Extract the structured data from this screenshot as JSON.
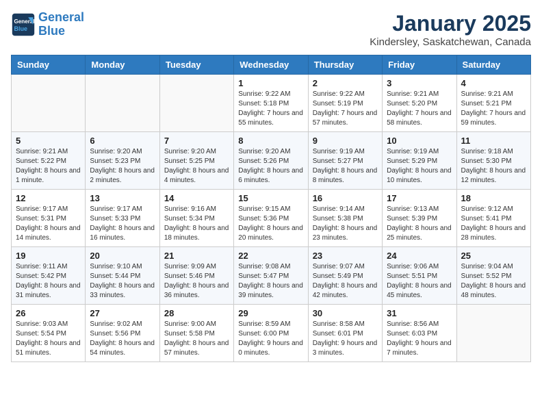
{
  "header": {
    "logo_line1": "General",
    "logo_line2": "Blue",
    "month": "January 2025",
    "location": "Kindersley, Saskatchewan, Canada"
  },
  "weekdays": [
    "Sunday",
    "Monday",
    "Tuesday",
    "Wednesday",
    "Thursday",
    "Friday",
    "Saturday"
  ],
  "weeks": [
    [
      {
        "day": "",
        "info": ""
      },
      {
        "day": "",
        "info": ""
      },
      {
        "day": "",
        "info": ""
      },
      {
        "day": "1",
        "info": "Sunrise: 9:22 AM\nSunset: 5:18 PM\nDaylight: 7 hours and 55 minutes."
      },
      {
        "day": "2",
        "info": "Sunrise: 9:22 AM\nSunset: 5:19 PM\nDaylight: 7 hours and 57 minutes."
      },
      {
        "day": "3",
        "info": "Sunrise: 9:21 AM\nSunset: 5:20 PM\nDaylight: 7 hours and 58 minutes."
      },
      {
        "day": "4",
        "info": "Sunrise: 9:21 AM\nSunset: 5:21 PM\nDaylight: 7 hours and 59 minutes."
      }
    ],
    [
      {
        "day": "5",
        "info": "Sunrise: 9:21 AM\nSunset: 5:22 PM\nDaylight: 8 hours and 1 minute."
      },
      {
        "day": "6",
        "info": "Sunrise: 9:20 AM\nSunset: 5:23 PM\nDaylight: 8 hours and 2 minutes."
      },
      {
        "day": "7",
        "info": "Sunrise: 9:20 AM\nSunset: 5:25 PM\nDaylight: 8 hours and 4 minutes."
      },
      {
        "day": "8",
        "info": "Sunrise: 9:20 AM\nSunset: 5:26 PM\nDaylight: 8 hours and 6 minutes."
      },
      {
        "day": "9",
        "info": "Sunrise: 9:19 AM\nSunset: 5:27 PM\nDaylight: 8 hours and 8 minutes."
      },
      {
        "day": "10",
        "info": "Sunrise: 9:19 AM\nSunset: 5:29 PM\nDaylight: 8 hours and 10 minutes."
      },
      {
        "day": "11",
        "info": "Sunrise: 9:18 AM\nSunset: 5:30 PM\nDaylight: 8 hours and 12 minutes."
      }
    ],
    [
      {
        "day": "12",
        "info": "Sunrise: 9:17 AM\nSunset: 5:31 PM\nDaylight: 8 hours and 14 minutes."
      },
      {
        "day": "13",
        "info": "Sunrise: 9:17 AM\nSunset: 5:33 PM\nDaylight: 8 hours and 16 minutes."
      },
      {
        "day": "14",
        "info": "Sunrise: 9:16 AM\nSunset: 5:34 PM\nDaylight: 8 hours and 18 minutes."
      },
      {
        "day": "15",
        "info": "Sunrise: 9:15 AM\nSunset: 5:36 PM\nDaylight: 8 hours and 20 minutes."
      },
      {
        "day": "16",
        "info": "Sunrise: 9:14 AM\nSunset: 5:38 PM\nDaylight: 8 hours and 23 minutes."
      },
      {
        "day": "17",
        "info": "Sunrise: 9:13 AM\nSunset: 5:39 PM\nDaylight: 8 hours and 25 minutes."
      },
      {
        "day": "18",
        "info": "Sunrise: 9:12 AM\nSunset: 5:41 PM\nDaylight: 8 hours and 28 minutes."
      }
    ],
    [
      {
        "day": "19",
        "info": "Sunrise: 9:11 AM\nSunset: 5:42 PM\nDaylight: 8 hours and 31 minutes."
      },
      {
        "day": "20",
        "info": "Sunrise: 9:10 AM\nSunset: 5:44 PM\nDaylight: 8 hours and 33 minutes."
      },
      {
        "day": "21",
        "info": "Sunrise: 9:09 AM\nSunset: 5:46 PM\nDaylight: 8 hours and 36 minutes."
      },
      {
        "day": "22",
        "info": "Sunrise: 9:08 AM\nSunset: 5:47 PM\nDaylight: 8 hours and 39 minutes."
      },
      {
        "day": "23",
        "info": "Sunrise: 9:07 AM\nSunset: 5:49 PM\nDaylight: 8 hours and 42 minutes."
      },
      {
        "day": "24",
        "info": "Sunrise: 9:06 AM\nSunset: 5:51 PM\nDaylight: 8 hours and 45 minutes."
      },
      {
        "day": "25",
        "info": "Sunrise: 9:04 AM\nSunset: 5:52 PM\nDaylight: 8 hours and 48 minutes."
      }
    ],
    [
      {
        "day": "26",
        "info": "Sunrise: 9:03 AM\nSunset: 5:54 PM\nDaylight: 8 hours and 51 minutes."
      },
      {
        "day": "27",
        "info": "Sunrise: 9:02 AM\nSunset: 5:56 PM\nDaylight: 8 hours and 54 minutes."
      },
      {
        "day": "28",
        "info": "Sunrise: 9:00 AM\nSunset: 5:58 PM\nDaylight: 8 hours and 57 minutes."
      },
      {
        "day": "29",
        "info": "Sunrise: 8:59 AM\nSunset: 6:00 PM\nDaylight: 9 hours and 0 minutes."
      },
      {
        "day": "30",
        "info": "Sunrise: 8:58 AM\nSunset: 6:01 PM\nDaylight: 9 hours and 3 minutes."
      },
      {
        "day": "31",
        "info": "Sunrise: 8:56 AM\nSunset: 6:03 PM\nDaylight: 9 hours and 7 minutes."
      },
      {
        "day": "",
        "info": ""
      }
    ]
  ]
}
